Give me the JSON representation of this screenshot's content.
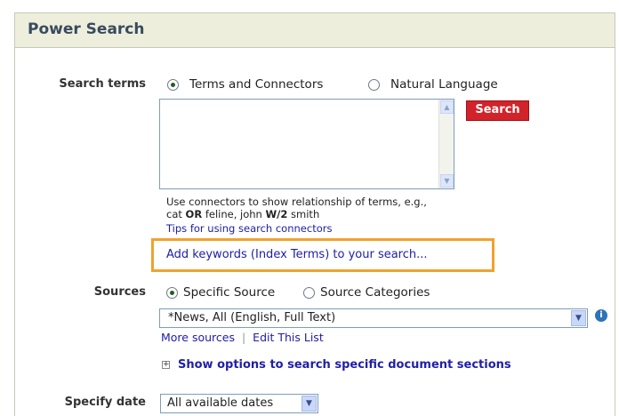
{
  "panel": {
    "title": "Power Search"
  },
  "search_terms": {
    "label": "Search terms",
    "options": [
      {
        "label": "Terms and Connectors",
        "checked": true
      },
      {
        "label": "Natural Language",
        "checked": false
      }
    ],
    "text_value": "",
    "search_button": "Search",
    "help_line1": "Use connectors to show relationship of terms, e.g.,",
    "help_ex_a": "cat ",
    "help_ex_or": "OR",
    "help_ex_b": " feline, john ",
    "help_ex_w2": "W/2",
    "help_ex_c": " smith",
    "tips_link": "Tips for using search connectors",
    "add_keywords_link": "Add keywords (Index Terms) to your search..."
  },
  "sources": {
    "label": "Sources",
    "options": [
      {
        "label": "Specific Source",
        "checked": true
      },
      {
        "label": "Source Categories",
        "checked": false
      }
    ],
    "selected": "*News, All (English, Full Text)",
    "more_sources": "More sources",
    "separator": "|",
    "edit_list": "Edit This List",
    "info_icon": "i"
  },
  "sections": {
    "expand_symbol": "+",
    "label": "Show options to search specific document sections"
  },
  "date": {
    "label": "Specify date",
    "selected": "All available dates"
  },
  "colors": {
    "header_bg": "#eeeedd",
    "title": "#384b5f",
    "search_button": "#d2232a",
    "highlight_box": "#f0a22e",
    "link": "#2020a8"
  }
}
